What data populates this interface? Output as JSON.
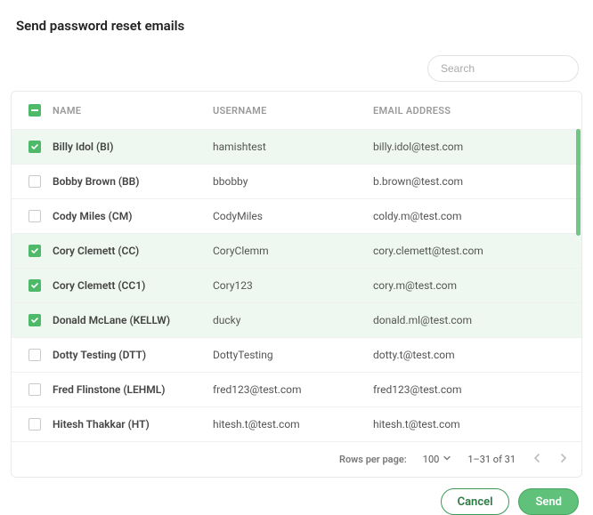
{
  "title": "Send password reset emails",
  "search": {
    "placeholder": "Search",
    "value": ""
  },
  "table": {
    "headers": {
      "name": "NAME",
      "username": "USERNAME",
      "email": "EMAIL ADDRESS"
    },
    "rows": [
      {
        "selected": true,
        "name": "Billy Idol (BI)",
        "username": "hamishtest",
        "email": "billy.idol@test.com"
      },
      {
        "selected": false,
        "name": "Bobby Brown (BB)",
        "username": "bbobby",
        "email": "b.brown@test.com"
      },
      {
        "selected": false,
        "name": "Cody Miles (CM)",
        "username": "CodyMiles",
        "email": "coldy.m@test.com"
      },
      {
        "selected": true,
        "name": "Cory Clemett (CC)",
        "username": "CoryClemm",
        "email": "cory.clemett@test.com"
      },
      {
        "selected": true,
        "name": "Cory Clemett (CC1)",
        "username": "Cory123",
        "email": "cory.m@test.com"
      },
      {
        "selected": true,
        "name": "Donald McLane (KELLW)",
        "username": "ducky",
        "email": "donald.ml@test.com"
      },
      {
        "selected": false,
        "name": "Dotty Testing (DTT)",
        "username": "DottyTesting",
        "email": "dotty.t@test.com"
      },
      {
        "selected": false,
        "name": "Fred Flinstone (LEHML)",
        "username": "fred123@test.com",
        "email": "fred123@test.com"
      },
      {
        "selected": false,
        "name": "Hitesh Thakkar (HT)",
        "username": "hitesh.t@test.com",
        "email": "hitesh.t@test.com"
      }
    ]
  },
  "pager": {
    "rows_per_page_label": "Rows per page:",
    "rows_per_page_value": "100",
    "range": "1–31 of 31"
  },
  "buttons": {
    "cancel": "Cancel",
    "send": "Send"
  }
}
